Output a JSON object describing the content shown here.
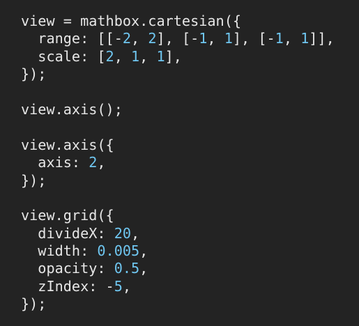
{
  "editor": {
    "background": "#232323",
    "text_color": "#e6e6e6",
    "number_color": "#6fc6f0",
    "lines": [
      [
        {
          "t": "plain",
          "v": "view = mathbox.cartesian({"
        }
      ],
      [
        {
          "t": "plain",
          "v": "  range: [[-"
        },
        {
          "t": "num",
          "v": "2"
        },
        {
          "t": "plain",
          "v": ", "
        },
        {
          "t": "num",
          "v": "2"
        },
        {
          "t": "plain",
          "v": "], [-"
        },
        {
          "t": "num",
          "v": "1"
        },
        {
          "t": "plain",
          "v": ", "
        },
        {
          "t": "num",
          "v": "1"
        },
        {
          "t": "plain",
          "v": "], [-"
        },
        {
          "t": "num",
          "v": "1"
        },
        {
          "t": "plain",
          "v": ", "
        },
        {
          "t": "num",
          "v": "1"
        },
        {
          "t": "plain",
          "v": "]],"
        }
      ],
      [
        {
          "t": "plain",
          "v": "  scale: ["
        },
        {
          "t": "num",
          "v": "2"
        },
        {
          "t": "plain",
          "v": ", "
        },
        {
          "t": "num",
          "v": "1"
        },
        {
          "t": "plain",
          "v": ", "
        },
        {
          "t": "num",
          "v": "1"
        },
        {
          "t": "plain",
          "v": "],"
        }
      ],
      [
        {
          "t": "plain",
          "v": "});"
        }
      ],
      [
        {
          "t": "plain",
          "v": ""
        }
      ],
      [
        {
          "t": "plain",
          "v": "view.axis();"
        }
      ],
      [
        {
          "t": "plain",
          "v": ""
        }
      ],
      [
        {
          "t": "plain",
          "v": "view.axis({"
        }
      ],
      [
        {
          "t": "plain",
          "v": "  axis: "
        },
        {
          "t": "num",
          "v": "2"
        },
        {
          "t": "plain",
          "v": ","
        }
      ],
      [
        {
          "t": "plain",
          "v": "});"
        }
      ],
      [
        {
          "t": "plain",
          "v": ""
        }
      ],
      [
        {
          "t": "plain",
          "v": "view.grid({"
        }
      ],
      [
        {
          "t": "plain",
          "v": "  divideX: "
        },
        {
          "t": "num",
          "v": "20"
        },
        {
          "t": "plain",
          "v": ","
        }
      ],
      [
        {
          "t": "plain",
          "v": "  width: "
        },
        {
          "t": "num",
          "v": "0.005"
        },
        {
          "t": "plain",
          "v": ","
        }
      ],
      [
        {
          "t": "plain",
          "v": "  opacity: "
        },
        {
          "t": "num",
          "v": "0.5"
        },
        {
          "t": "plain",
          "v": ","
        }
      ],
      [
        {
          "t": "plain",
          "v": "  zIndex: -"
        },
        {
          "t": "num",
          "v": "5"
        },
        {
          "t": "plain",
          "v": ","
        }
      ],
      [
        {
          "t": "plain",
          "v": "});"
        }
      ]
    ]
  }
}
